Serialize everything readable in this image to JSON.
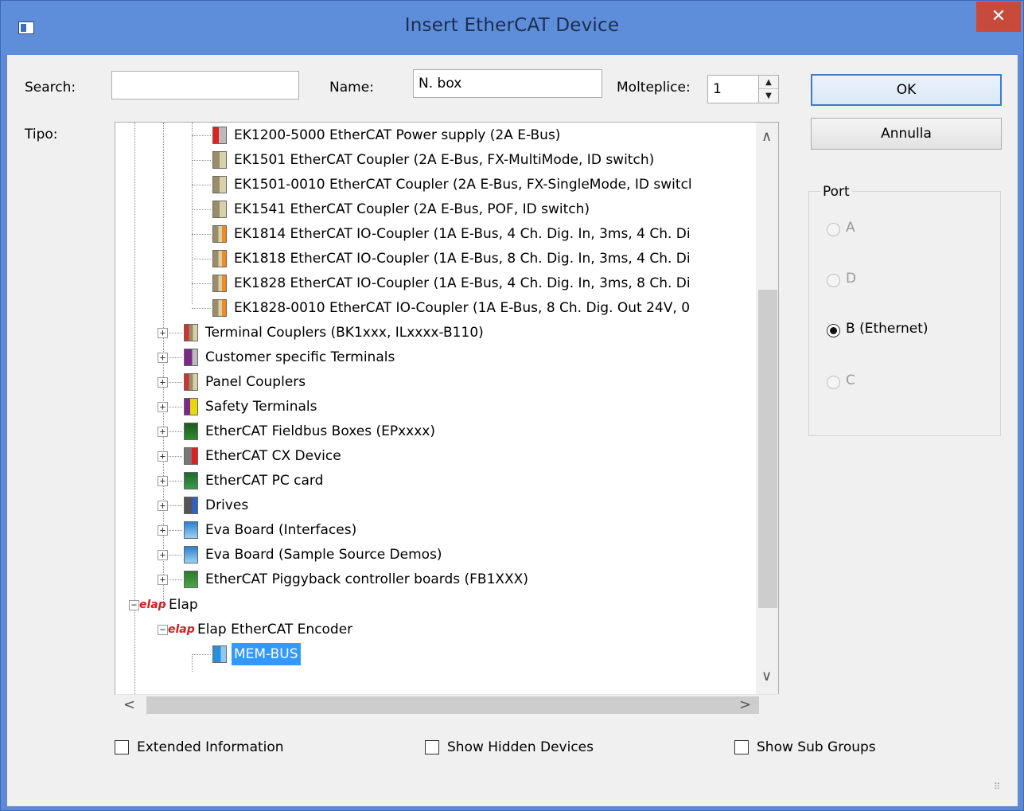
{
  "window": {
    "title": "Insert EtherCAT Device",
    "close_glyph": "✕"
  },
  "form": {
    "search_label": "Search:",
    "search_value": "",
    "name_label": "Name:",
    "name_value": "N. box",
    "molteplice_label": "Molteplice:",
    "molteplice_value": "1",
    "tipo_label": "Tipo:"
  },
  "buttons": {
    "ok": "OK",
    "cancel": "Annulla"
  },
  "port": {
    "title": "Port",
    "options": [
      {
        "label": "A",
        "enabled": false,
        "selected": false
      },
      {
        "label": "D",
        "enabled": false,
        "selected": false
      },
      {
        "label": "B (Ethernet)",
        "enabled": true,
        "selected": true
      },
      {
        "label": "C",
        "enabled": false,
        "selected": false
      }
    ]
  },
  "tree": {
    "items": [
      {
        "label": "EK1200-5000 EtherCAT Power supply (2A E-Bus)",
        "icon": "power-supply-icon"
      },
      {
        "label": "EK1501 EtherCAT Coupler (2A E-Bus, FX-MultiMode, ID switch)",
        "icon": "coupler-icon"
      },
      {
        "label": "EK1501-0010 EtherCAT Coupler (2A E-Bus, FX-SingleMode, ID switcl",
        "icon": "coupler-icon"
      },
      {
        "label": "EK1541 EtherCAT Coupler (2A E-Bus, POF, ID switch)",
        "icon": "coupler-icon"
      },
      {
        "label": "EK1814 EtherCAT IO-Coupler  (1A E-Bus, 4 Ch. Dig. In, 3ms, 4 Ch. Di",
        "icon": "io-coupler-icon"
      },
      {
        "label": "EK1818 EtherCAT IO-Coupler  (1A E-Bus, 8 Ch. Dig. In, 3ms, 4 Ch. Di",
        "icon": "io-coupler-icon"
      },
      {
        "label": "EK1828 EtherCAT IO-Coupler  (1A E-Bus, 4 Ch. Dig. In, 3ms, 8 Ch. Di",
        "icon": "io-coupler-icon"
      },
      {
        "label": "EK1828-0010 EtherCAT IO-Coupler  (1A E-Bus, 8 Ch. Dig. Out 24V, 0",
        "icon": "io-coupler-icon"
      },
      {
        "label": "Terminal Couplers (BK1xxx, ILxxxx-B110)",
        "icon": "terminal-coupler-icon"
      },
      {
        "label": "Customer specific Terminals",
        "icon": "customer-terminal-icon"
      },
      {
        "label": "Panel Couplers",
        "icon": "terminal-coupler-icon"
      },
      {
        "label": "Safety Terminals",
        "icon": "safety-terminal-icon"
      },
      {
        "label": "EtherCAT Fieldbus Boxes (EPxxxx)",
        "icon": "fieldbus-box-icon"
      },
      {
        "label": "EtherCAT CX Device",
        "icon": "cx-device-icon"
      },
      {
        "label": "EtherCAT PC card",
        "icon": "pc-card-icon"
      },
      {
        "label": "Drives",
        "icon": "drive-icon"
      },
      {
        "label": "Eva Board (Interfaces)",
        "icon": "eva-board-icon"
      },
      {
        "label": "Eva Board (Sample Source Demos)",
        "icon": "eva-board-icon"
      },
      {
        "label": "EtherCAT Piggyback controller boards (FB1XXX)",
        "icon": "piggyback-board-icon"
      },
      {
        "label": "Elap",
        "icon": "elap-logo-icon"
      },
      {
        "label": "Elap EtherCAT Encoder",
        "icon": "elap-logo-icon"
      },
      {
        "label": "MEM-BUS",
        "icon": "encoder-icon"
      }
    ],
    "expander_collapsed": "+",
    "expander_expanded": "−",
    "elap_logo_text": "elap"
  },
  "scroll": {
    "up": "∧",
    "down": "∨",
    "left": "<",
    "right": ">"
  },
  "options": {
    "extended_info": "Extended Information",
    "show_hidden": "Show Hidden Devices",
    "show_sub_groups": "Show Sub Groups"
  },
  "colors": {
    "title_bar": "#5e8dd9",
    "selection": "#3399ff",
    "close_button": "#c74a3a"
  }
}
